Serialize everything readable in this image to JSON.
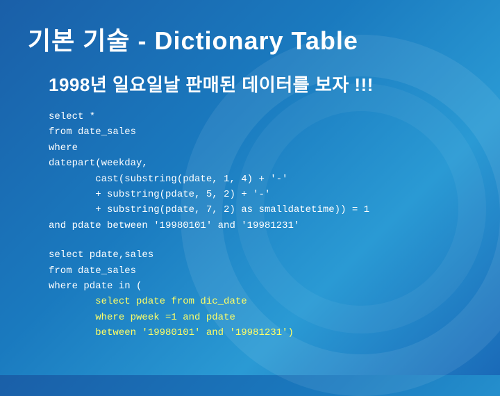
{
  "title": "기본 기술 - Dictionary Table",
  "subtitle": "1998년 일요일날 판매된 데이터를 보자 !!!",
  "code_block1": {
    "lines": [
      "select *",
      "from date_sales",
      "where",
      "datepart(weekday,",
      "        cast(substring(pdate, 1, 4) + '-'",
      "        + substring(pdate, 5, 2) + '-'",
      "        + substring(pdate, 7, 2) as smalldatetime)) = 1",
      "and pdate between '19980101' and '19981231'"
    ]
  },
  "code_block2": {
    "lines_white": [
      "select pdate,sales",
      "from date_sales",
      "where pdate in ("
    ],
    "lines_yellow": [
      "        select pdate from dic_date",
      "        where pweek =1 and pdate",
      "        between '19980101' and '19981231')"
    ]
  },
  "colors": {
    "background_start": "#1a5fa8",
    "background_end": "#2a9ad4",
    "text_primary": "#ffffff",
    "text_highlight": "#ffff66"
  }
}
